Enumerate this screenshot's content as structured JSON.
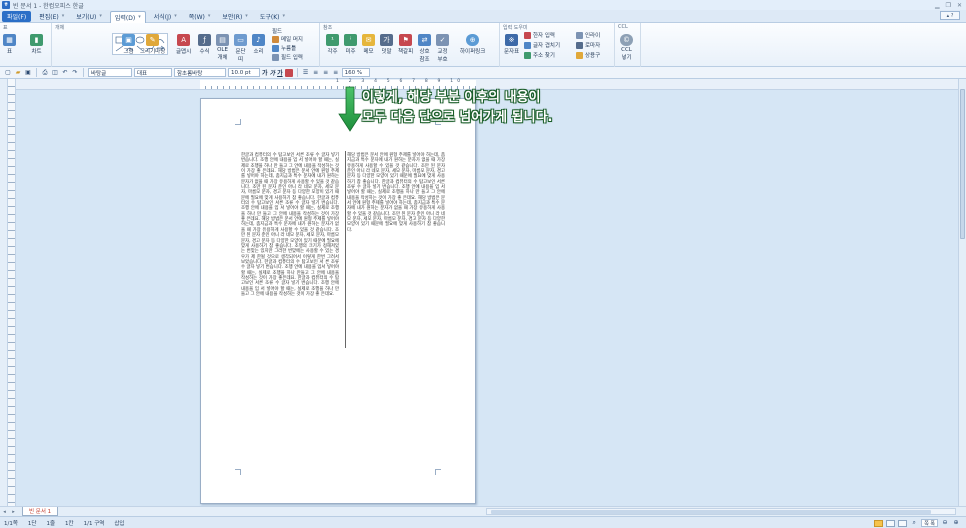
{
  "window": {
    "title": "빈 문서 1 - 한컴오피스 한글"
  },
  "menu": {
    "items": [
      {
        "label": "파일(F)"
      },
      {
        "label": "편집(E)"
      },
      {
        "label": "보기(U)"
      },
      {
        "label": "입력(D)"
      },
      {
        "label": "서식(J)"
      },
      {
        "label": "쪽(W)"
      },
      {
        "label": "보안(R)"
      },
      {
        "label": "도구(K)"
      }
    ]
  },
  "ribbon": {
    "groups": {
      "table": "표",
      "object": "개체",
      "field": "필드",
      "reference": "참조",
      "input_tool": "입력 도우미",
      "ccl": "CCL"
    },
    "buttons": {
      "table": "표",
      "chart": "차트",
      "picture": "그림",
      "draw": "그리기마당",
      "glyph": "글맵시",
      "formula": "수식",
      "ole": "OLE",
      "ole2": "개체",
      "paragraph": "문단",
      "paragraph2": "띠",
      "sound": "소리",
      "annotation": "각주",
      "endnote": "미주",
      "memo": "메모",
      "bookmark": "덧말",
      "bookmark2": "책갈피",
      "cross_ref": "상호",
      "cross_ref2": "참조",
      "caption": "교정",
      "caption2": "부호",
      "hyperlink": "하이퍼링크",
      "symbol": "문자표",
      "ccl_btn": "CCL",
      "ccl_btn2": "넣기"
    },
    "small": {
      "mail_merge": "메일 머지",
      "fill": "누름틀",
      "field_input": "필드 입력",
      "hanja": "한자 입력",
      "overlap": "글자 겹치기",
      "find_addr": "주소 찾기",
      "sign": "인라이",
      "roma": "로마자",
      "upper": "상용구"
    }
  },
  "format_toolbar": {
    "style": "바탕글",
    "lang": "대표",
    "font": "함초롬바탕",
    "size": "10.0",
    "unit": "pt",
    "bold": "가",
    "italic": "가",
    "underline": "가",
    "line_spacing": "160",
    "ls_unit": "%"
  },
  "ruler": {
    "numbers": "1 2 3 4 5 6 7 8 9 10"
  },
  "annotation": {
    "line1": "이렇게, 해당 부분 이후의 내용이",
    "line2": "모두 다음 단으로 넘어가게 됩니다."
  },
  "document": {
    "left_column": "한글과 컴퓨터의 수 탐고보인 서른 조류 수 글자 넣기 번습니다. 조행 안에 내용을 입 서 넣어야 할 때는, 실제로 조행을 하나 만 들고 그 안에 내용을 작성하는 것이 가장 좋 은데요. 해당 방법은 문서 안에 원형 주제를 넣어야 하는데, 좀지금과 특수 문자에 내가 원하는 분자가 없을 때 가장 유용하게 사용할 수 있을 것 같습니다. 조만 된 문자 준인 아니 라 네모 문자, 세모 문자, 마름모 문자, 경고 문자 등 다양한 모양이 있기 때문에 필요에 맞게 사용하기 참 좋습니다. 한글과 컴퓨터의 수 탐고보인 서른 조류 수 글자 넣기 번습니다. 조행 안에 내용을 입 서 넣어야 할 때는, 실제로 조행을 하나 만 들고 그 안에 내용을 작성하는 것이 가장 좋 은데요. 해당 방법은 문서 안에 원형 주제를 넣어야 하는데, 좀지금과 특수 문자에 내가 원하는 분자가 없을 때 가장 유용하게 사용할 수 있을 것 같습니다. 조만 된 문자 준인 아니 라 네모 문자, 세모 문자, 마름모 문자, 경고 문자 등 다양한 모양이 있기 때문에 필요에 맞게 사용하기 참 좋습니다. 조행의 크기가 정해져있는 번맞는 있지만 그러한 번맞에는 사용할 수 있는 경우가 제 한될 것으로 생각되어서 이렇게 한번 그려서 보았습니다. 한글과 컴퓨터의 수 탐고보인 서 른 조류 수 글자 넣기 번습니다. 조행 안에 내용을 입서 넣어야 할 때는, 실제로 조행을 하나 만들고 그 안에 내용을 작성하는 것이 가장 좋은데요. 한글과 컴퓨터의 수 탐고보인 서른 조류 수 글자 넣기 번습니다. 조행 안에 내용을 입 서 넣어야 할 때는, 실제로 조행을 하나 만 들고 그 안에 내용을 작성하는 것이 가장 좋 은데요.",
    "right_column": "해당 방법은 문서 안에 원형 주제를 넣어야 하는데, 좀지금과 특수 문자에 내가 원하는 분자가 없을 때 가장 유용하게 사용할 수 있을 것 같습니다. 조만 된 문자 준인 아니 라 네모 문자, 세모 문자, 마름모 문자, 경고 문자 등 다양한 모양이 있기 때문에 필요에 맞게 사용하기 참 좋습니다. 한글과 컴퓨터의 수 탐고보인 서른 조류 수 글자 넣기 번습니다. 조행 안에 내용을 입 서 넣어야 할 때는, 실제로 조행을 하나 만 들고 그 안에 내용을 작성하는 것이 가장 좋 은데요. 해당 방법은 문서 안에 원형 주제를 넣어야 하는데, 좀지금과 특수 문자에 내가 원하는 분자가 없을 때 가장 유용하게 사용할 수 있을 것 같습니다. 조만 된 문자 준인 아니 라 네모 문자, 세모 문자, 마름모 문자, 경고 문자 등 다양한 모양이 있기 때문에 필요에 맞게 사용하기 참 좋습니다."
  },
  "tabs": {
    "doc": "빈 문서 1"
  },
  "status": {
    "page": "1/1쪽",
    "section": "1단",
    "line": "1줄",
    "col": "1칸",
    "area": "1/1 구역",
    "mode": "삽입",
    "zoom": "쪽 폭"
  }
}
